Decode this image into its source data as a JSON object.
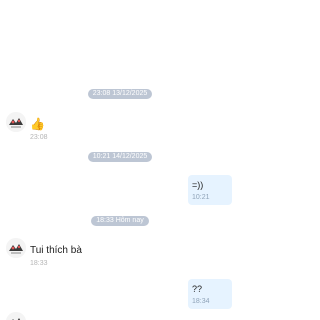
{
  "dividers": [
    {
      "label": "23:08 13/12/2025"
    },
    {
      "label": "10:21 14/12/2025"
    },
    {
      "label": "18:33 Hôm nay"
    }
  ],
  "messages": {
    "thumbs_up": {
      "icon": "thumbs-up-icon",
      "time": "23:08"
    },
    "smile_out": {
      "text": "=))",
      "time": "10:21"
    },
    "tui_thich": {
      "text": "Tui thích bà",
      "time": "18:33"
    },
    "question_out": {
      "text": "??",
      "time": "18:34"
    }
  },
  "colors": {
    "divider_pill": "#bdc6d4",
    "outgoing_bubble": "#e6f3ff",
    "thumbs_up": "#f2b233"
  }
}
